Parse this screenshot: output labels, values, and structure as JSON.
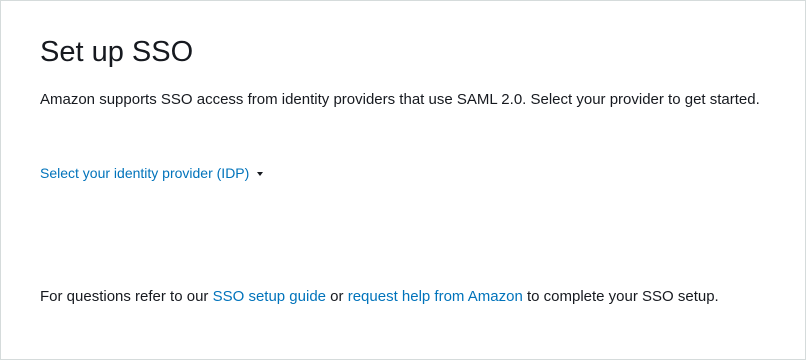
{
  "header": {
    "title": "Set up SSO"
  },
  "description": "Amazon supports SSO access from identity providers that use SAML 2.0. Select your provider to get started.",
  "idp_dropdown": {
    "label": "Select your identity provider (IDP)",
    "icon": "caret-down-icon"
  },
  "footer": {
    "prefix": "For questions refer to our ",
    "setup_guide_link": "SSO setup guide",
    "middle": " or ",
    "help_link": "request help from Amazon",
    "suffix": " to complete your SSO setup."
  },
  "colors": {
    "link": "#0073bb",
    "text": "#16191f",
    "border": "#d5dbdb"
  }
}
